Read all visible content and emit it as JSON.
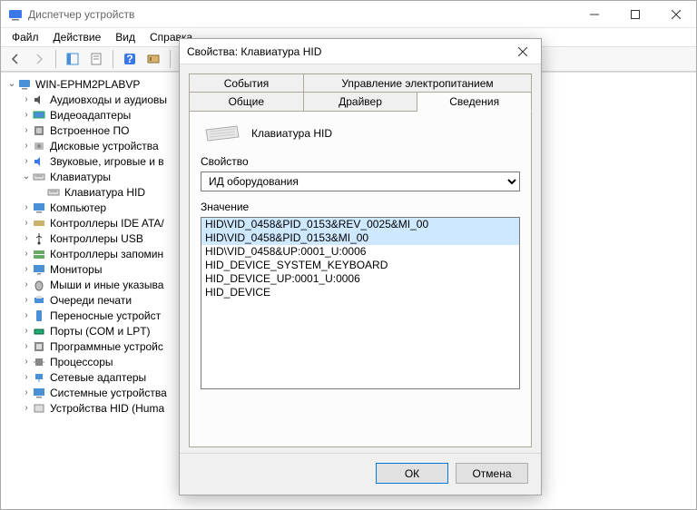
{
  "window": {
    "title": "Диспетчер устройств"
  },
  "menu": {
    "file": "Файл",
    "action": "Действие",
    "view": "Вид",
    "help": "Справка"
  },
  "tree": {
    "root": "WIN-EPHM2PLABVP",
    "items": [
      "Аудиовходы и аудиовы",
      "Видеоадаптеры",
      "Встроенное ПО",
      "Дисковые устройства",
      "Звуковые, игровые и в"
    ],
    "keyboards": "Клавиатуры",
    "hid_keyboard": "Клавиатура HID",
    "rest": [
      "Компьютер",
      "Контроллеры IDE ATA/",
      "Контроллеры USB",
      "Контроллеры запомин",
      "Мониторы",
      "Мыши и иные указыва",
      "Очереди печати",
      "Переносные устройст",
      "Порты (COM и LPT)",
      "Программные устройс",
      "Процессоры",
      "Сетевые адаптеры",
      "Системные устройства",
      "Устройства HID (Huma"
    ]
  },
  "dialog": {
    "title": "Свойства: Клавиатура HID",
    "tabs": {
      "events": "События",
      "power": "Управление электропитанием",
      "general": "Общие",
      "driver": "Драйвер",
      "details": "Сведения"
    },
    "device_name": "Клавиатура HID",
    "property_label": "Свойство",
    "property_selected": "ИД оборудования",
    "value_label": "Значение",
    "values": [
      "HID\\VID_0458&PID_0153&REV_0025&MI_00",
      "HID\\VID_0458&PID_0153&MI_00",
      "HID\\VID_0458&UP:0001_U:0006",
      "HID_DEVICE_SYSTEM_KEYBOARD",
      "HID_DEVICE_UP:0001_U:0006",
      "HID_DEVICE"
    ],
    "ok": "ОК",
    "cancel": "Отмена"
  }
}
